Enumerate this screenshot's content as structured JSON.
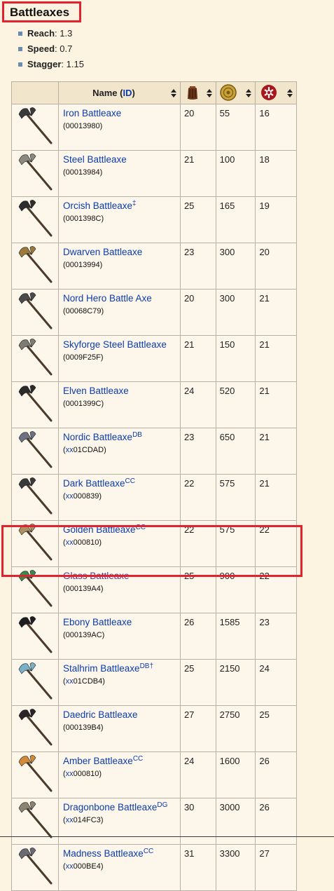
{
  "heading": "Battleaxes",
  "stats": [
    {
      "label": "Reach",
      "value": ": 1.3"
    },
    {
      "label": "Speed",
      "value": ": 0.7"
    },
    {
      "label": "Stagger",
      "value": ": 1.15"
    }
  ],
  "table": {
    "header": {
      "name_prefix": "Name (",
      "name_id": "ID",
      "name_suffix": ")"
    },
    "header_icons": [
      "weight-icon",
      "gold-coin-icon",
      "damage-icon"
    ],
    "rows": [
      {
        "name": "Iron Battleaxe",
        "sup": "",
        "id_prefix": "",
        "id": "00013980",
        "weight": "20",
        "value": "55",
        "damage": "16",
        "blade": "#3a3a3a",
        "visited": false
      },
      {
        "name": "Steel Battleaxe",
        "sup": "",
        "id_prefix": "",
        "id": "00013984",
        "weight": "21",
        "value": "100",
        "damage": "18",
        "blade": "#8a8a80",
        "visited": false
      },
      {
        "name": "Orcish Battleaxe",
        "sup": "‡",
        "id_prefix": "",
        "id": "0001398C",
        "weight": "25",
        "value": "165",
        "damage": "19",
        "blade": "#2e2e2e",
        "visited": false
      },
      {
        "name": "Dwarven Battleaxe",
        "sup": "",
        "id_prefix": "",
        "id": "00013994",
        "weight": "23",
        "value": "300",
        "damage": "20",
        "blade": "#9a7a3a",
        "visited": false
      },
      {
        "name": "Nord Hero Battle Axe",
        "sup": "",
        "id_prefix": "",
        "id": "00068C79",
        "weight": "20",
        "value": "300",
        "damage": "21",
        "blade": "#4a4a4a",
        "visited": false
      },
      {
        "name": "Skyforge Steel Battleaxe",
        "sup": "",
        "id_prefix": "",
        "id": "0009F25F",
        "weight": "21",
        "value": "150",
        "damage": "21",
        "blade": "#7c7c74",
        "visited": false
      },
      {
        "name": "Elven Battleaxe",
        "sup": "",
        "id_prefix": "",
        "id": "0001399C",
        "weight": "24",
        "value": "520",
        "damage": "21",
        "blade": "#2a2a2a",
        "visited": false
      },
      {
        "name": "Nordic Battleaxe",
        "sup": "DB",
        "id_prefix": "xx",
        "id": "01CDAD",
        "weight": "23",
        "value": "650",
        "damage": "21",
        "blade": "#6c7280",
        "visited": false
      },
      {
        "name": "Dark Battleaxe",
        "sup": "CC",
        "id_prefix": "xx",
        "id": "000839",
        "weight": "22",
        "value": "575",
        "damage": "21",
        "blade": "#3a3a3a",
        "visited": false
      },
      {
        "name": "Golden Battleaxe",
        "sup": "CC",
        "id_prefix": "xx",
        "id": "000810",
        "weight": "22",
        "value": "575",
        "damage": "22",
        "blade": "#b09060",
        "visited": false
      },
      {
        "name": "Glass Battleaxe",
        "sup": "",
        "id_prefix": "",
        "id": "000139A4",
        "weight": "25",
        "value": "900",
        "damage": "22",
        "blade": "#3a8a4a",
        "visited": true
      },
      {
        "name": "Ebony Battleaxe",
        "sup": "",
        "id_prefix": "",
        "id": "000139AC",
        "weight": "26",
        "value": "1585",
        "damage": "23",
        "blade": "#1e1e22",
        "visited": false
      },
      {
        "name": "Stalhrim Battleaxe",
        "sup": "DB†",
        "id_prefix": "xx",
        "id": "01CDB4",
        "weight": "25",
        "value": "2150",
        "damage": "24",
        "blade": "#7ab0c8",
        "visited": false
      },
      {
        "name": "Daedric Battleaxe",
        "sup": "",
        "id_prefix": "",
        "id": "000139B4",
        "weight": "27",
        "value": "2750",
        "damage": "25",
        "blade": "#2a2426",
        "visited": false
      },
      {
        "name": "Amber Battleaxe",
        "sup": "CC",
        "id_prefix": "xx",
        "id": "000810",
        "weight": "24",
        "value": "1600",
        "damage": "26",
        "blade": "#d08a3a",
        "visited": false
      },
      {
        "name": "Dragonbone Battleaxe",
        "sup": "DG",
        "id_prefix": "xx",
        "id": "014FC3",
        "weight": "30",
        "value": "3000",
        "damage": "26",
        "blade": "#8a8470",
        "visited": false
      },
      {
        "name": "Madness Battleaxe",
        "sup": "CC",
        "id_prefix": "xx",
        "id": "000BE4",
        "weight": "31",
        "value": "3300",
        "damage": "27",
        "blade": "#6a6a72",
        "visited": false
      }
    ]
  }
}
